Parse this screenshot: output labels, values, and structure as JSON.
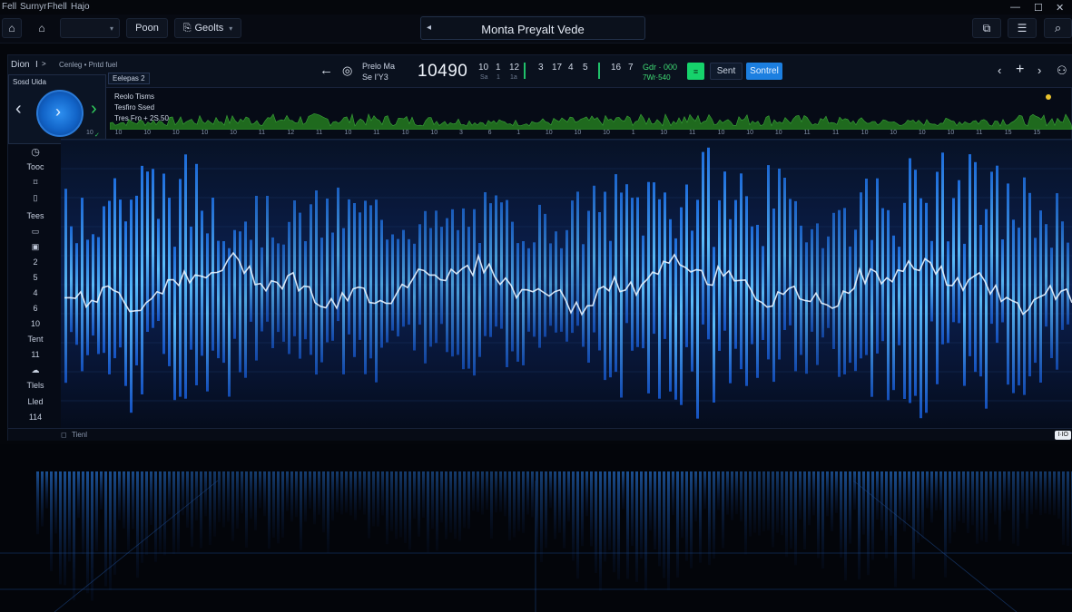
{
  "menubar": {
    "items": [
      "Fell",
      "Surnyr",
      "Fhell",
      "Hajo"
    ]
  },
  "window_controls": {
    "minimize": "—",
    "restore": "☐",
    "close": "✕"
  },
  "toolbar": {
    "dropdown_label": "",
    "left_buttons": [
      "Poon",
      "Geolts"
    ],
    "title": "Monta Preyalt Vede"
  },
  "transport": {
    "tab_label": "Dion",
    "tab_index": "I",
    "breadcrumb": "Cenleg • Pntd fuel",
    "preset": "Eelepas 2",
    "mode_line1": "Prelo Ma",
    "mode_line2": "Se I'Y3",
    "time": "10490",
    "counters": [
      {
        "top": "10",
        "sub": "Sa"
      },
      {
        "top": "1",
        "sub": "1"
      },
      {
        "top": "12",
        "sub": "1a"
      },
      {
        "top": "3",
        "sub": ""
      },
      {
        "top": "17",
        "sub": ""
      },
      {
        "top": "4",
        "sub": ""
      },
      {
        "top": "5",
        "sub": ""
      },
      {
        "top": "16",
        "sub": ""
      },
      {
        "top": "7",
        "sub": ""
      }
    ],
    "range_top": "Gdr · 000",
    "range_sub": "7Wr·540",
    "green_button": "≡",
    "button_sent": "Sent",
    "button_control": "Sontrel"
  },
  "sidebar": {
    "preview_label": "Sosd Uida",
    "preview_status": "✓",
    "items": [
      "Tooc",
      "Tees",
      "2",
      "5",
      "4",
      "6",
      "10",
      "Tent",
      "11",
      "Tlels",
      "Lled",
      "114"
    ]
  },
  "info": {
    "line1": "Reolo Tisms",
    "line2": "Tesfiro Ssed",
    "line3": "Tres Fro + 2S.50"
  },
  "ruler": [
    "10",
    "10",
    "10",
    "10",
    "10",
    "10",
    "11",
    "12",
    "11",
    "10",
    "11",
    "10",
    "10",
    "3",
    "6",
    "1",
    "10",
    "10",
    "10",
    "1",
    "10",
    "11",
    "10",
    "10",
    "10",
    "11",
    "11",
    "10",
    "10",
    "10",
    "10",
    "11",
    "15",
    "15"
  ],
  "status": {
    "left": "Tienl",
    "right": "I·IO"
  },
  "colors": {
    "accent": "#1b8cf0",
    "green": "#16d36b",
    "wave_bright": "#4fb3ff",
    "overview": "#2f8f2a"
  }
}
